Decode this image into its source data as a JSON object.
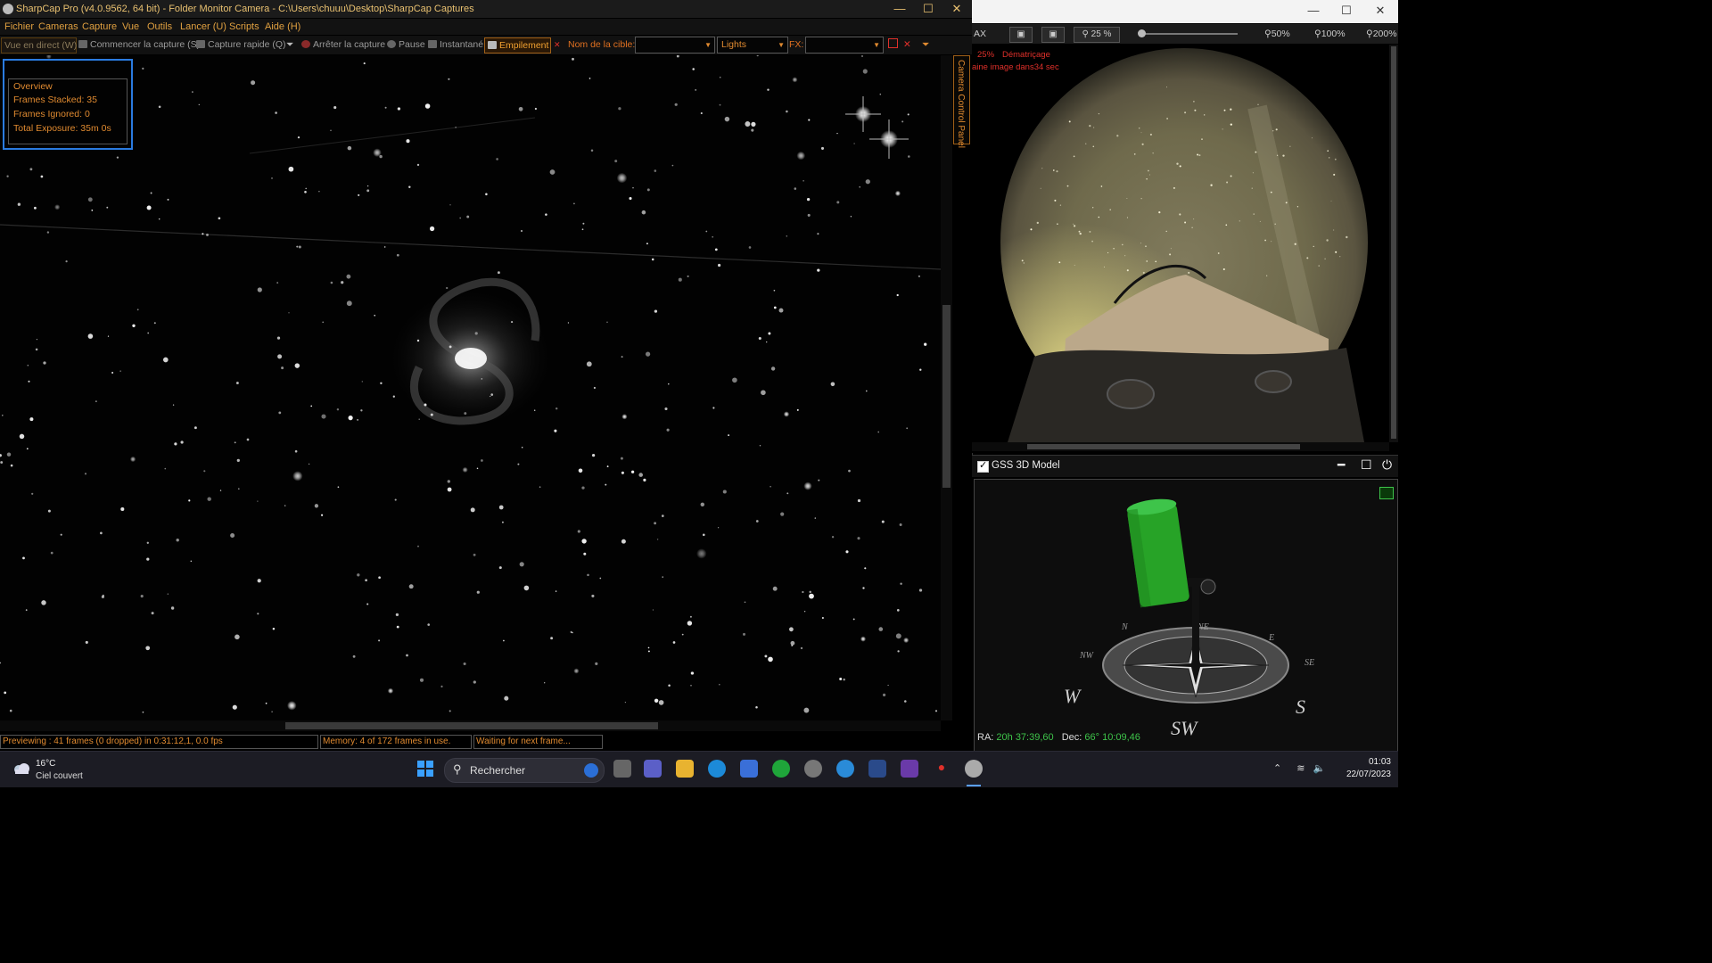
{
  "sharpcap": {
    "title": "SharpCap Pro (v4.0.9562, 64 bit) - Folder Monitor Camera - C:\\Users\\chuuu\\Desktop\\SharpCap Captures",
    "window_controls": [
      "—",
      "☐",
      "✕"
    ],
    "menu": [
      "Fichier",
      "Cameras",
      "Capture",
      "Vue",
      "Outils",
      "Lancer (U)",
      "Scripts",
      "Aide (H)"
    ],
    "toolbar": {
      "live_view": "Vue en direct (W)",
      "start_capture": "Commencer la capture (S)",
      "quick_capture": "Capture rapide (Q)",
      "stop_capture": "Arrêter la capture",
      "pause": "Pause",
      "snapshot": "Instantané",
      "stacking": "Empilement",
      "target_name_label": "Nom de la cible:",
      "target_name_value": "",
      "frame_type": "Lights",
      "fx_label": "FX:",
      "fx_value": ""
    },
    "overview": {
      "heading": "Overview",
      "frames_stacked": "Frames Stacked: 35",
      "frames_ignored": "Frames Ignored: 0",
      "total_exposure": "Total Exposure:   35m 0s"
    },
    "side_panel_tab": "Camera Control Panel",
    "status": {
      "preview": "Previewing : 41 frames (0 dropped) in 0:31:12,1, 0.0 fps",
      "memory": "Memory: 4 of 172 frames in use.",
      "waiting": "Waiting for next frame..."
    }
  },
  "allsky": {
    "window_controls": [
      "—",
      "☐",
      "✕"
    ],
    "toolbar": {
      "fit_label": "AX",
      "zoom_current": "25 %",
      "zoom_50": "50%",
      "zoom_100": "100%",
      "zoom_200": "200%"
    },
    "overlay": {
      "zoom": "25%",
      "debayer": "Dématriçage",
      "next_image": "aine image dans34 sec"
    }
  },
  "gss": {
    "title": "GSS 3D Model",
    "enabled": true,
    "compass": [
      "W",
      "SW",
      "S",
      "SE",
      "E",
      "NE",
      "N",
      "NW"
    ],
    "ra_label": "RA:",
    "ra_value": "20h 37:39,60",
    "dec_label": "Dec:",
    "dec_value": "66° 10:09,46"
  },
  "taskbar": {
    "weather_temp": "16°C",
    "weather_condition": "Ciel couvert",
    "search_placeholder": "Rechercher",
    "time": "01:03",
    "date": "22/07/2023"
  },
  "colors": {
    "accent_orange": "#e08a30",
    "accent_red": "#e0302a",
    "readout_green": "#3ec44a",
    "focus_blue": "#2a7be0"
  }
}
